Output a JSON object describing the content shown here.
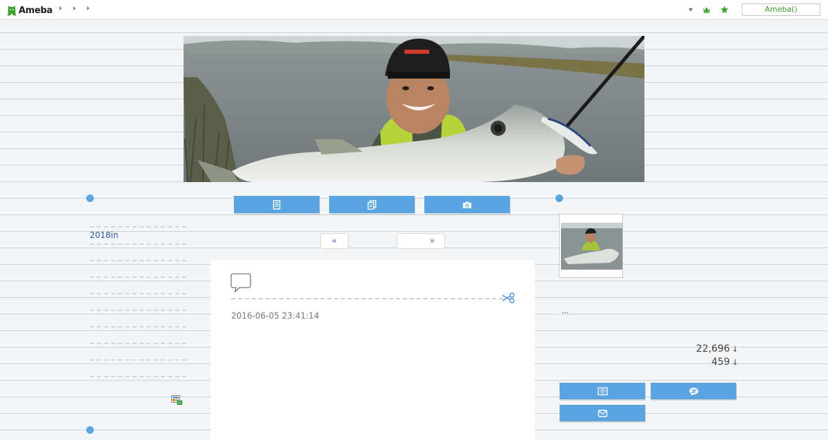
{
  "topbar": {
    "logo_text": "Ameba",
    "login_label": "Ameba()",
    "accent_color": "#3aa02c"
  },
  "header": {
    "photo_alt": "header photo"
  },
  "nav": {
    "tabs": [
      {
        "icon": "document-icon"
      },
      {
        "icon": "copy-icon"
      },
      {
        "icon": "camera-icon"
      }
    ]
  },
  "pager": {
    "prev_label": "«",
    "next_label": "»"
  },
  "left_sidebar": {
    "link_text": "2018in"
  },
  "article": {
    "date": "2016-06-05 23:41:14"
  },
  "right_sidebar": {
    "profile_text": "...",
    "reader_count": "22,696",
    "follow_count": "459",
    "arrow": "↓",
    "buttons": [
      {
        "icon": "book-icon"
      },
      {
        "icon": "chat-icon"
      },
      {
        "icon": "mail-icon"
      }
    ]
  },
  "colors": {
    "button_blue": "#5aa5e1",
    "link_blue": "#2b5aa0"
  }
}
